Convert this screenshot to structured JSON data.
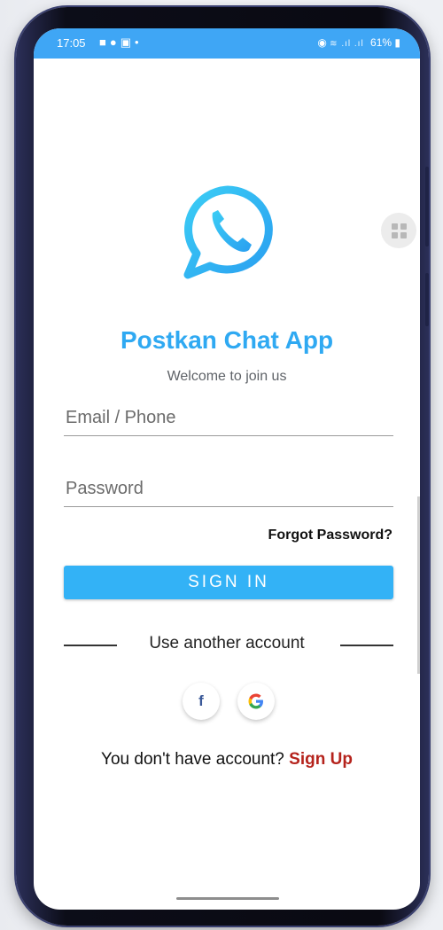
{
  "status_bar": {
    "time": "17:05",
    "left_icons": [
      "video-icon",
      "messenger-icon",
      "gallery-icon",
      "dot-icon"
    ],
    "right_icons": [
      "alarm-icon",
      "wifi-icon",
      "signal-icon",
      "battery-icon"
    ],
    "battery": "61%"
  },
  "app": {
    "title": "Postkan Chat App",
    "subtitle": "Welcome to join us",
    "logo": "chat-phone-icon",
    "accent_color": "#3ba9f2"
  },
  "form": {
    "email_placeholder": "Email / Phone",
    "password_placeholder": "Password",
    "forgot_label": "Forgot Password?",
    "signin_label": "SIGN IN"
  },
  "social": {
    "divider_label": "Use another account",
    "facebook": "f",
    "google": "G"
  },
  "signup": {
    "prompt": "You don't have account?",
    "link": "Sign Up",
    "link_color": "#b5231c"
  }
}
